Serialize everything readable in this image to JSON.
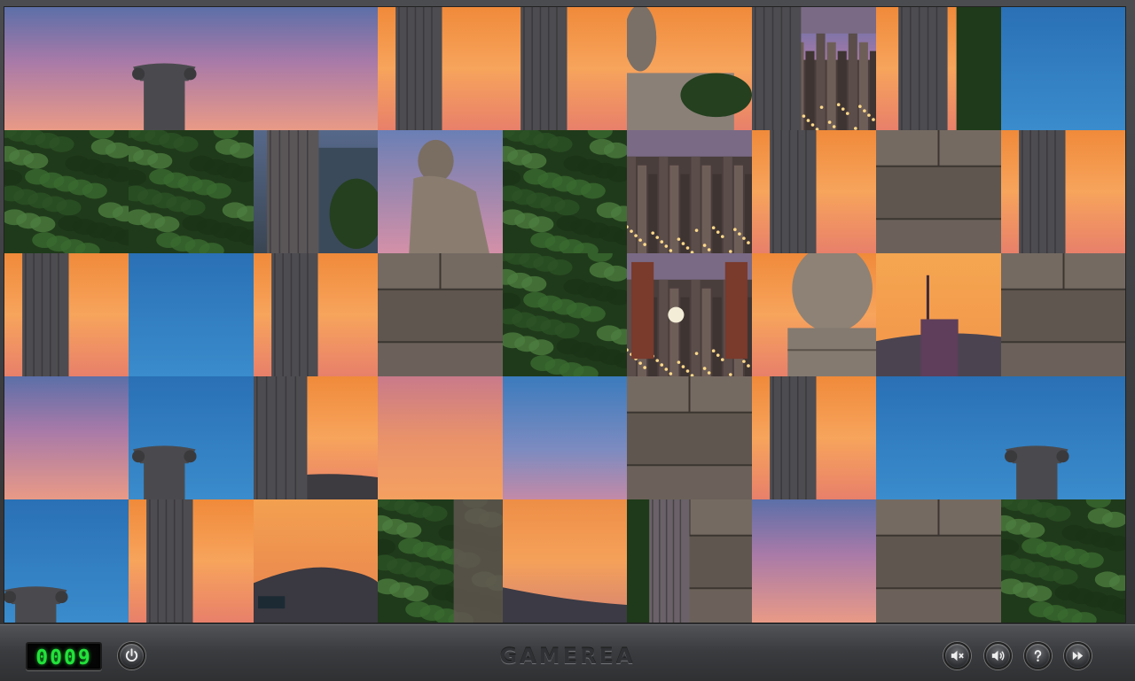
{
  "game": {
    "brand": "GAMEREA",
    "timer": "0009",
    "grid": {
      "cols": 9,
      "rows": 5
    }
  },
  "icons": {
    "power": "power-icon",
    "mute": "sound-off-icon",
    "sound": "sound-on-icon",
    "help": "help-icon",
    "next": "fast-forward-icon"
  },
  "colors": {
    "timer_digits": "#22e33a",
    "toolbar": "#3a3c3f",
    "sunset_orange": "#f59a4a",
    "sky_blue": "#2f82c4",
    "dusk_purple": "#7a6a95",
    "foliage": "#1f3a1a",
    "stone": "#6b615a",
    "city": "#4a3e3c"
  },
  "tiles": [
    {
      "row": 0,
      "col": 0,
      "kind": "sky-pink"
    },
    {
      "row": 0,
      "col": 1,
      "kind": "column-capital"
    },
    {
      "row": 0,
      "col": 2,
      "kind": "sky-pink"
    },
    {
      "row": 0,
      "col": 3,
      "kind": "column-sunset"
    },
    {
      "row": 0,
      "col": 4,
      "kind": "column-sunset"
    },
    {
      "row": 0,
      "col": 5,
      "kind": "statue-sky"
    },
    {
      "row": 0,
      "col": 6,
      "kind": "column-city"
    },
    {
      "row": 0,
      "col": 7,
      "kind": "column-trees"
    },
    {
      "row": 1,
      "col": 0,
      "kind": "foliage"
    },
    {
      "row": 1,
      "col": 1,
      "kind": "foliage"
    },
    {
      "row": 1,
      "col": 2,
      "kind": "column-building"
    },
    {
      "row": 1,
      "col": 3,
      "kind": "statue-figure"
    },
    {
      "row": 1,
      "col": 4,
      "kind": "foliage"
    },
    {
      "row": 1,
      "col": 5,
      "kind": "city"
    },
    {
      "row": 1,
      "col": 6,
      "kind": "column-sunset"
    },
    {
      "row": 1,
      "col": 7,
      "kind": "stone"
    },
    {
      "row": 2,
      "col": 0,
      "kind": "column-sunset"
    },
    {
      "row": 2,
      "col": 1,
      "kind": "sky-blue"
    },
    {
      "row": 2,
      "col": 2,
      "kind": "column-sunset"
    },
    {
      "row": 2,
      "col": 3,
      "kind": "stone"
    },
    {
      "row": 2,
      "col": 4,
      "kind": "foliage"
    },
    {
      "row": 2,
      "col": 5,
      "kind": "city-towers"
    },
    {
      "row": 2,
      "col": 6,
      "kind": "statue-base"
    },
    {
      "row": 2,
      "col": 7,
      "kind": "sky-tower"
    },
    {
      "row": 3,
      "col": 0,
      "kind": "sky-pink"
    },
    {
      "row": 3,
      "col": 1,
      "kind": "column-capital-blue"
    },
    {
      "row": 3,
      "col": 2,
      "kind": "column-hill"
    },
    {
      "row": 3,
      "col": 3,
      "kind": "sky-orange"
    },
    {
      "row": 3,
      "col": 4,
      "kind": "sky-blue-pink"
    },
    {
      "row": 3,
      "col": 5,
      "kind": "stone"
    },
    {
      "row": 3,
      "col": 6,
      "kind": "column-sunset"
    },
    {
      "row": 3,
      "col": 7,
      "kind": "sky-blue"
    },
    {
      "row": 3,
      "col": 8,
      "kind": "column-capital-blue"
    },
    {
      "row": 4,
      "col": 0,
      "kind": "capital-blue"
    },
    {
      "row": 4,
      "col": 1,
      "kind": "column-sunset"
    },
    {
      "row": 4,
      "col": 2,
      "kind": "hill-sunset"
    },
    {
      "row": 4,
      "col": 3,
      "kind": "foliage-stone"
    },
    {
      "row": 4,
      "col": 4,
      "kind": "hill-orange"
    },
    {
      "row": 4,
      "col": 5,
      "kind": "stone-column"
    },
    {
      "row": 4,
      "col": 6,
      "kind": "sky-pink"
    },
    {
      "row": 4,
      "col": 7,
      "kind": "stone"
    },
    {
      "row": 4,
      "col": 8,
      "kind": "foliage"
    }
  ]
}
